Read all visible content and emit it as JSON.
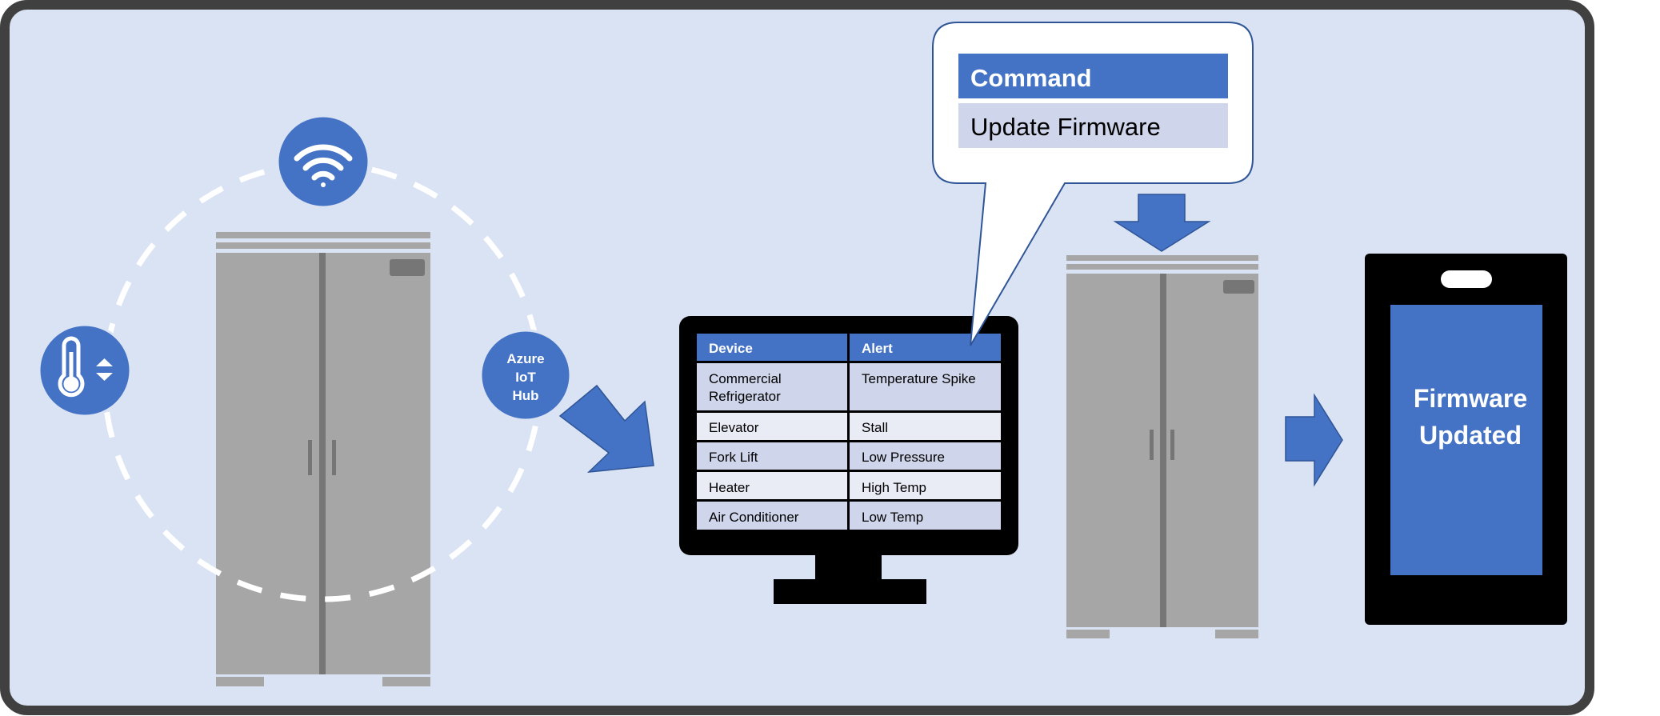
{
  "colors": {
    "background": "#dae3f3",
    "frame": "#404040",
    "accent_blue": "#4472c4",
    "appliance_gray": "#a6a6a6",
    "appliance_dark_gray": "#767676",
    "screen_black": "#000000",
    "table_header_text": "#ffffff",
    "table_row_odd": "#cfd5ea",
    "table_row_even": "#e9ebf5",
    "callout_header": "#4472c4",
    "callout_row": "#cfd5ea"
  },
  "icons": {
    "wifi": "wifi-icon",
    "thermometer": "thermometer-icon",
    "updown": "up-down-arrows-icon"
  },
  "hub": {
    "line1": "Azure",
    "line2": "IoT",
    "line3": "Hub"
  },
  "alerts_table": {
    "headers": [
      "Device",
      "Alert"
    ],
    "rows": [
      {
        "device_line1": "Commercial",
        "device_line2": "Refrigerator",
        "alert": "Temperature Spike"
      },
      {
        "device_line1": "Elevator",
        "device_line2": "",
        "alert": "Stall"
      },
      {
        "device_line1": "Fork Lift",
        "device_line2": "",
        "alert": "Low Pressure"
      },
      {
        "device_line1": "Heater",
        "device_line2": "",
        "alert": "High Temp"
      },
      {
        "device_line1": "Air Conditioner",
        "device_line2": "",
        "alert": "Low Temp"
      }
    ]
  },
  "callout": {
    "header": "Command",
    "value": "Update Firmware"
  },
  "phone": {
    "line1": "Firmware",
    "line2": "Updated"
  }
}
